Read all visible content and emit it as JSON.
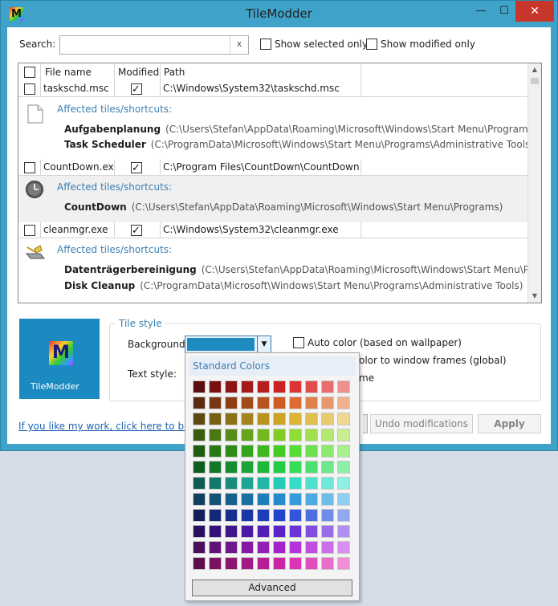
{
  "window": {
    "title": "TileModder",
    "icon_letter": "M",
    "min_glyph": "—",
    "max_glyph": "☐",
    "close_glyph": "✕"
  },
  "search": {
    "label": "Search:",
    "value": "",
    "clear_glyph": "x",
    "show_selected_label": "Show selected only",
    "show_modified_label": "Show modified only",
    "show_selected_checked": false,
    "show_modified_checked": false
  },
  "grid": {
    "columns": [
      "File name",
      "Modified",
      "Path"
    ],
    "affected_label": "Affected tiles/shortcuts:",
    "rows": [
      {
        "file": "taskschd.msc",
        "modified": true,
        "path": "C:\\Windows\\System32\\taskschd.msc",
        "icon": "document-icon",
        "shortcuts": [
          {
            "name": "Aufgabenplanung",
            "path": "(C:\\Users\\Stefan\\AppData\\Roaming\\Microsoft\\Windows\\Start Menu\\Programs)"
          },
          {
            "name": "Task Scheduler",
            "path": "(C:\\ProgramData\\Microsoft\\Windows\\Start Menu\\Programs\\Administrative Tools)"
          }
        ]
      },
      {
        "file": "CountDown.exe",
        "modified": true,
        "path": "C:\\Program Files\\CountDown\\CountDown.exe",
        "icon": "clock-icon",
        "shortcuts": [
          {
            "name": "CountDown",
            "path": "(C:\\Users\\Stefan\\AppData\\Roaming\\Microsoft\\Windows\\Start Menu\\Programs)"
          }
        ]
      },
      {
        "file": "cleanmgr.exe",
        "modified": true,
        "path": "C:\\Windows\\System32\\cleanmgr.exe",
        "icon": "disk-cleanup-icon",
        "shortcuts": [
          {
            "name": "Datenträgerbereinigung",
            "path": "(C:\\Users\\Stefan\\AppData\\Roaming\\Microsoft\\Windows\\Start Menu\\Programs)"
          },
          {
            "name": "Disk Cleanup",
            "path": "(C:\\ProgramData\\Microsoft\\Windows\\Start Menu\\Programs\\Administrative Tools)"
          }
        ]
      }
    ]
  },
  "tile": {
    "name": "TileModder",
    "logo_letter": "M",
    "background_color": "#1a8ac0"
  },
  "tile_style": {
    "title": "Tile style",
    "background_label": "Background:",
    "text_style_label": "Text style:",
    "auto_color_label": "Auto color (based on wallpaper)",
    "window_frames_label": "olor to window frames (global)",
    "third_option_label": "me",
    "background_color": "#1e8ac0"
  },
  "footer": {
    "link_text": "If you like my work, click here to buy me",
    "undo_label": "Undo modifications",
    "apply_label": "Apply"
  },
  "color_popup": {
    "header": "Standard Colors",
    "advanced_label": "Advanced",
    "rows": [
      [
        "#5c0f0f",
        "#781212",
        "#8c1616",
        "#a41a1a",
        "#b81e1e",
        "#cc2222",
        "#dd3333",
        "#e04d4d",
        "#e86e6e",
        "#ef8f8f"
      ],
      [
        "#5c2a0f",
        "#783612",
        "#8c3f16",
        "#a44a1a",
        "#b8521e",
        "#cc5c22",
        "#dd6c33",
        "#e0804d",
        "#e8986e",
        "#efb08f"
      ],
      [
        "#5c4a0f",
        "#786012",
        "#8c7016",
        "#a4841a",
        "#b8941e",
        "#cca422",
        "#ddb433",
        "#e0bf4d",
        "#e8cb6e",
        "#efd88f"
      ],
      [
        "#3a5c0f",
        "#4a7812",
        "#578c16",
        "#66a41a",
        "#72b81e",
        "#80cc22",
        "#90dd33",
        "#a0e04d",
        "#b4e86e",
        "#c8ef8f"
      ],
      [
        "#1f5c0f",
        "#287812",
        "#2e8c16",
        "#36a41a",
        "#3db81e",
        "#44cc22",
        "#55dd33",
        "#6ee04d",
        "#8ce86e",
        "#a8ef8f"
      ],
      [
        "#0f5c1f",
        "#127828",
        "#168c2e",
        "#1aa436",
        "#1eb83d",
        "#22cc44",
        "#33dd55",
        "#4de06e",
        "#6ee88c",
        "#8fefa8"
      ],
      [
        "#0f5c52",
        "#12786b",
        "#168c7d",
        "#1aa492",
        "#1eb8a4",
        "#22ccb6",
        "#33ddc6",
        "#4de0cd",
        "#6ee8d8",
        "#8fefe2"
      ],
      [
        "#0f3f5c",
        "#125278",
        "#16608c",
        "#1a70a4",
        "#1e7eb8",
        "#228ccc",
        "#339cdd",
        "#4dabe0",
        "#6ebde8",
        "#8fcfef"
      ],
      [
        "#0f1f5c",
        "#122878",
        "#162e8c",
        "#1a36a4",
        "#1e3db8",
        "#2244cc",
        "#3355dd",
        "#4d6ee0",
        "#6e8ce8",
        "#8fa8ef"
      ],
      [
        "#2a0f5c",
        "#361278",
        "#3f168c",
        "#4a1aa4",
        "#521eb8",
        "#5c22cc",
        "#6c33dd",
        "#804de0",
        "#986ee8",
        "#b08fef"
      ],
      [
        "#4a0f5c",
        "#601278",
        "#70168c",
        "#841aa4",
        "#941eb8",
        "#a422cc",
        "#b433dd",
        "#bf4de0",
        "#cb6ee8",
        "#d88fef"
      ],
      [
        "#5c0f4a",
        "#781260",
        "#8c1670",
        "#a41a84",
        "#b81e94",
        "#cc22a4",
        "#dd33b4",
        "#e04dbf",
        "#e86ecb",
        "#ef8fd8"
      ]
    ]
  }
}
